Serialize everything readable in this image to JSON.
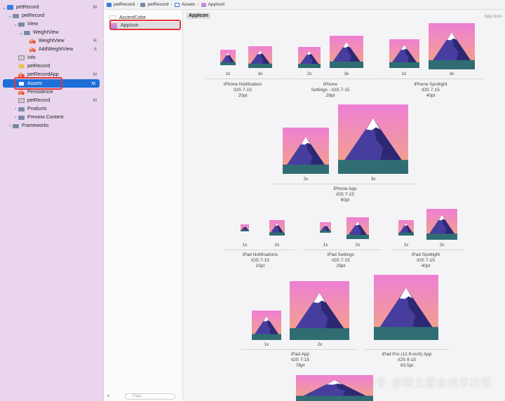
{
  "navigator": {
    "items": [
      {
        "label": "petRecord",
        "badge": "M",
        "icon": "project-icon"
      },
      {
        "label": "petRecord",
        "badge": "",
        "icon": "folder-icon"
      },
      {
        "label": "View",
        "badge": "",
        "icon": "folder-icon"
      },
      {
        "label": "WeightView",
        "badge": "",
        "icon": "folder-icon"
      },
      {
        "label": "WeightView",
        "badge": "R",
        "icon": "swift-file-icon"
      },
      {
        "label": "AddWeightView",
        "badge": "A",
        "icon": "swift-file-icon"
      },
      {
        "label": "Info",
        "badge": "",
        "icon": "plist-icon"
      },
      {
        "label": "petRecord",
        "badge": "",
        "icon": "entitlements-icon"
      },
      {
        "label": "petRecordApp",
        "badge": "M",
        "icon": "swift-file-icon"
      },
      {
        "label": "Assets",
        "badge": "M",
        "icon": "asset-catalog-icon"
      },
      {
        "label": "Persistence",
        "badge": "",
        "icon": "swift-file-icon"
      },
      {
        "label": "petRecord",
        "badge": "M",
        "icon": "data-model-icon"
      },
      {
        "label": "Products",
        "badge": "",
        "icon": "folder-icon"
      },
      {
        "label": "Preview Content",
        "badge": "",
        "icon": "folder-icon"
      },
      {
        "label": "Frameworks",
        "badge": "",
        "icon": "folder-icon"
      }
    ]
  },
  "breadcrumb": [
    "petRecord",
    "petRecord",
    "Assets",
    "AppIcon"
  ],
  "asset_list": {
    "items": [
      "AccentColor",
      "AppIcon"
    ],
    "filter_placeholder": "Filter"
  },
  "editor": {
    "set_title": "AppIcon",
    "set_type": "App Icon",
    "groups": [
      {
        "l1": "iPhone Notification",
        "l2": "iOS 7-15",
        "l3": "20pt",
        "scales": [
          "2x",
          "3x"
        ]
      },
      {
        "l1": "iPhone",
        "l2": "Settings - iOS 7-15",
        "l3": "29pt",
        "scales": [
          "2x",
          "3x"
        ]
      },
      {
        "l1": "iPhone Spotlight",
        "l2": "iOS 7-15",
        "l3": "40pt",
        "scales": [
          "2x",
          "3x"
        ]
      },
      {
        "l1": "iPhone App",
        "l2": "iOS 7-15",
        "l3": "60pt",
        "scales": [
          "2x",
          "3x"
        ]
      },
      {
        "l1": "iPad Notifications",
        "l2": "iOS 7-15",
        "l3": "20pt",
        "scales": [
          "1x",
          "2x"
        ]
      },
      {
        "l1": "iPad Settings",
        "l2": "iOS 7-15",
        "l3": "29pt",
        "scales": [
          "1x",
          "2x"
        ]
      },
      {
        "l1": "iPad Spotlight",
        "l2": "iOS 7-15",
        "l3": "40pt",
        "scales": [
          "1x",
          "2x"
        ]
      },
      {
        "l1": "iPad App",
        "l2": "iOS 7-15",
        "l3": "76pt",
        "scales": [
          "1x",
          "2x"
        ]
      },
      {
        "l1": "iPad Pro (12.9-inch) App",
        "l2": "iOS 9-15",
        "l3": "83.5pt",
        "scales": []
      }
    ]
  },
  "watermark": "知乎 @稀土掘金技术社区",
  "colors": {
    "selection": "#1f6fd9",
    "highlight_outline": "#e0393a",
    "sidebar_bg": "#e9d6ee"
  }
}
